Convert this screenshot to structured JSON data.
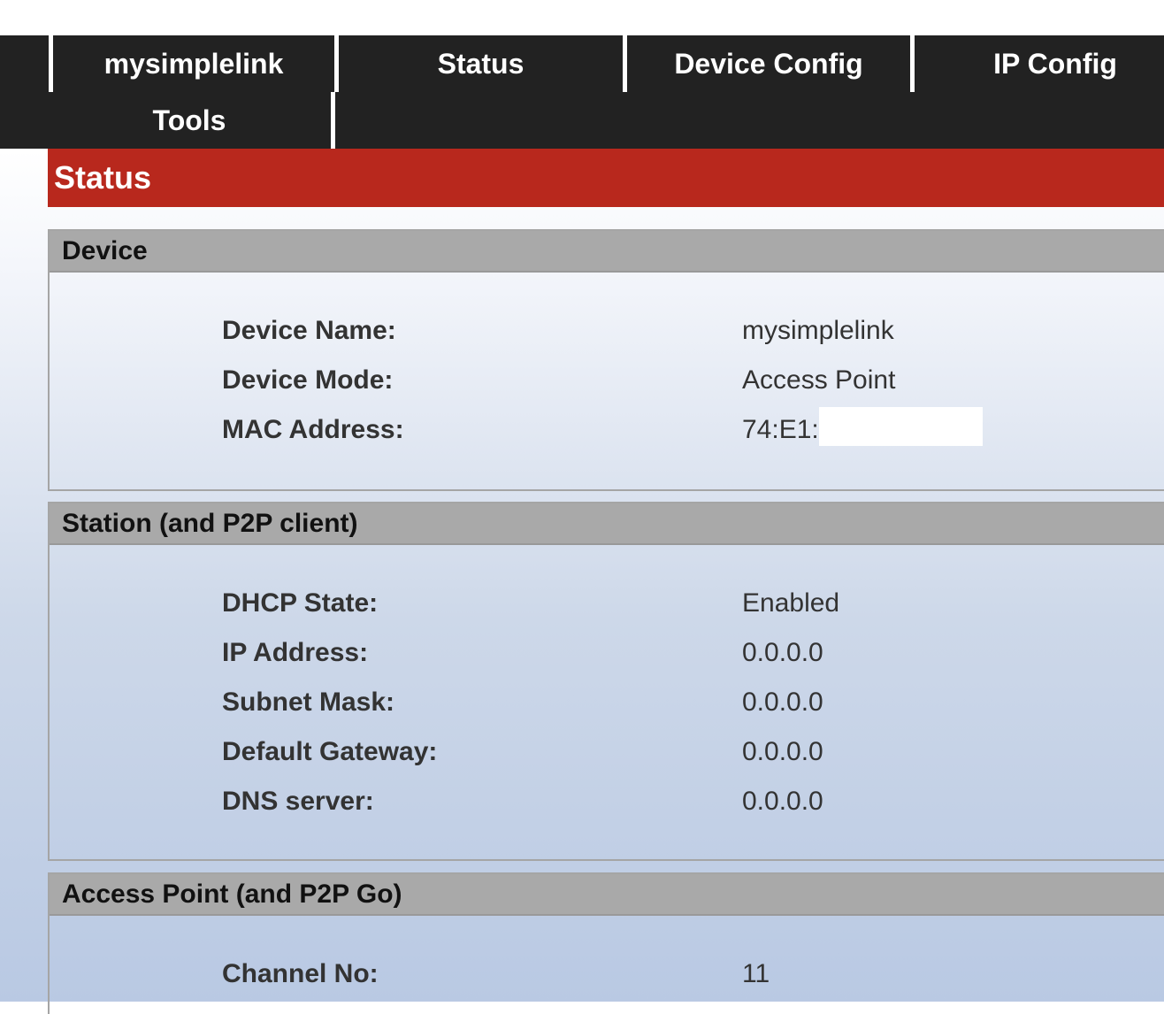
{
  "nav": {
    "items": [
      {
        "label": "mysimplelink"
      },
      {
        "label": "Status"
      },
      {
        "label": "Device Config"
      },
      {
        "label": "IP Config"
      },
      {
        "label": "Tools"
      }
    ]
  },
  "page": {
    "title": "Status"
  },
  "sections": {
    "device": {
      "title": "Device",
      "rows": [
        {
          "label": "Device Name:",
          "value": "mysimplelink"
        },
        {
          "label": "Device Mode:",
          "value": "Access Point"
        },
        {
          "label": "MAC Address:",
          "value": "74:E1:"
        }
      ]
    },
    "station": {
      "title": "Station (and P2P client)",
      "rows": [
        {
          "label": "DHCP State:",
          "value": "Enabled"
        },
        {
          "label": "IP Address:",
          "value": "0.0.0.0"
        },
        {
          "label": "Subnet Mask:",
          "value": "0.0.0.0"
        },
        {
          "label": "Default Gateway:",
          "value": "0.0.0.0"
        },
        {
          "label": "DNS server:",
          "value": "0.0.0.0"
        }
      ]
    },
    "ap": {
      "title": "Access Point (and P2P Go)",
      "rows": [
        {
          "label": "Channel No:",
          "value": "11"
        }
      ]
    }
  },
  "colors": {
    "nav_bg": "#222222",
    "title_bar": "#b8281d",
    "section_header": "#a9a9a9"
  }
}
